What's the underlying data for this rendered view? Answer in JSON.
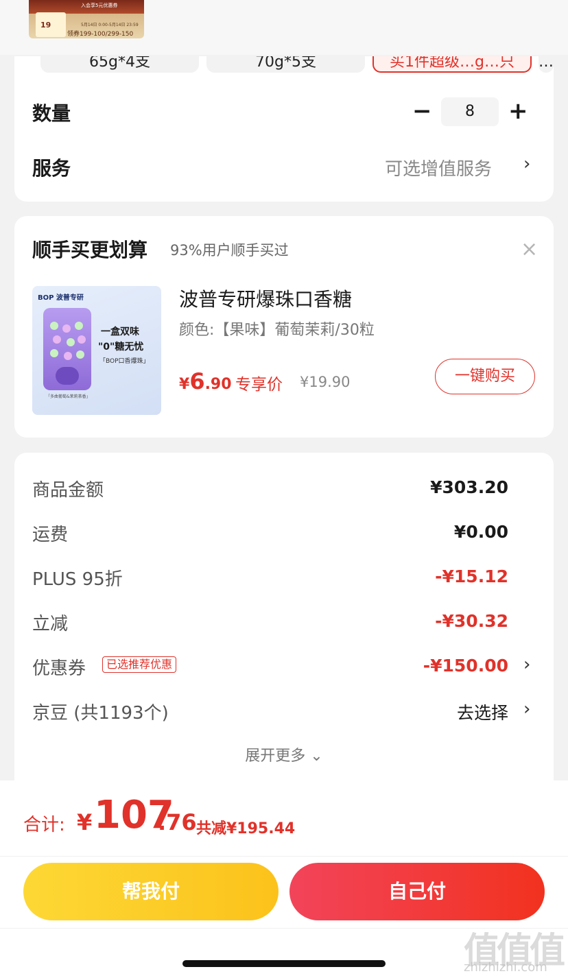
{
  "promo_banner": {
    "line1": "入会享5元优惠券",
    "badge_number": "19",
    "date_range": "5月14日 0:00-5月14日 23:59",
    "coupon_text": "领券199-100/299-150"
  },
  "specs": {
    "options": [
      "65g*4支",
      "70g*5支",
      "买1件超级…g…只",
      "…"
    ]
  },
  "quantity": {
    "label": "数量",
    "value": "8",
    "minus": "−",
    "plus": "+"
  },
  "service": {
    "label": "服务",
    "value": "可选增值服务",
    "chevron": "›"
  },
  "addon": {
    "title": "顺手买更划算",
    "subtitle": "93%用户顺手买过",
    "close": "×",
    "product": {
      "brand": "BOP 波普专研",
      "img_text1": "一盒双味",
      "img_text2": "\"0\"糖无忧",
      "img_text3": "「BOP口香爆珠」",
      "img_text4": "「多曲葡萄&茉莉茶香」",
      "name": "波普专研爆珠口香糖",
      "spec": "颜色:【果味】葡萄茉莉/30粒",
      "price_sym": "¥",
      "price_int": "6",
      "price_dec": ".90",
      "price_tag": "专享价",
      "old_price": "¥19.90",
      "buy_label": "一键购买"
    }
  },
  "breakdown": {
    "rows": [
      {
        "label": "商品金额",
        "value": "¥303.20"
      },
      {
        "label": "运费",
        "value": "¥0.00"
      },
      {
        "label": "PLUS 95折",
        "value": "-¥15.12"
      },
      {
        "label": "立减",
        "value": "-¥30.32"
      },
      {
        "label": "优惠券",
        "tag": "已选推荐优惠",
        "value": "-¥150.00"
      },
      {
        "label": "京豆 (共1193个)",
        "value": "去选择"
      }
    ],
    "expand": "展开更多 ⌄",
    "chevron": "›"
  },
  "total": {
    "label": "合计:",
    "sym": "¥",
    "int": "107",
    "dec": ".76",
    "saved": "共减¥195.44"
  },
  "buttons": {
    "help_pay": "帮我付",
    "self_pay": "自己付"
  },
  "watermark": {
    "text": "值值值",
    "url": "zhizhizhi.com"
  },
  "colors": {
    "accent_red": "#e0322a",
    "yellow": "#fcc21b"
  }
}
